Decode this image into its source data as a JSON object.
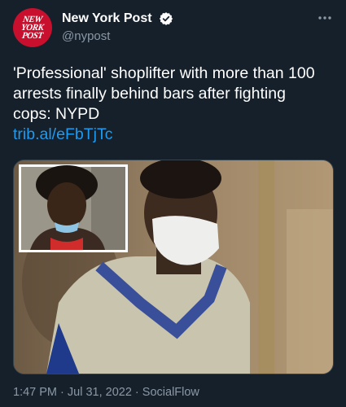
{
  "account": {
    "display_name": "New York Post",
    "handle": "@nypost",
    "avatar_text": [
      "NEW",
      "YORK",
      "POST"
    ]
  },
  "tweet": {
    "text": "'Professional' shoplifter with more than 100 arrests finally behind bars after fighting cops: NYPD",
    "link": "trib.al/eFbTjTc"
  },
  "meta": {
    "time": "1:47 PM",
    "separator": " · ",
    "date": "Jul 31, 2022",
    "source": "SocialFlow"
  },
  "colors": {
    "background": "#15202b",
    "text": "#ffffff",
    "secondary_text": "#8b98a5",
    "link": "#1d9bf0",
    "brand": "#c8102e"
  },
  "icons": [
    "verified-badge-icon",
    "more-options-icon"
  ]
}
